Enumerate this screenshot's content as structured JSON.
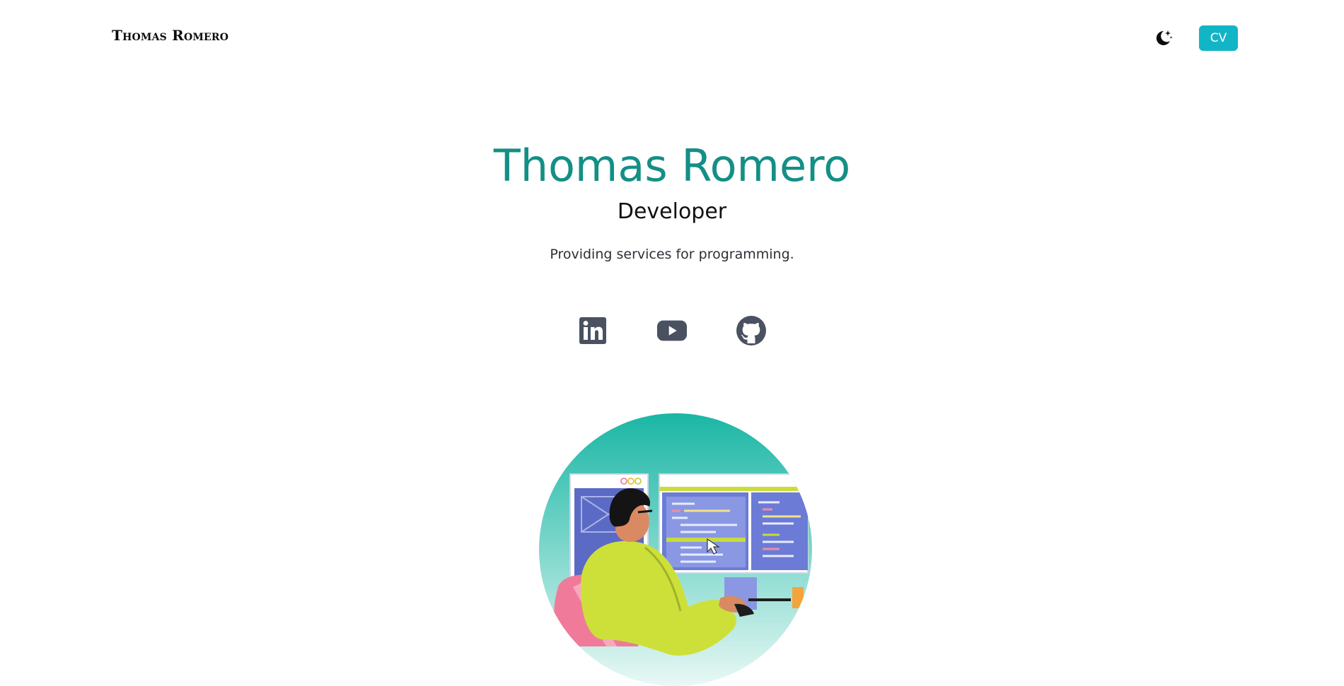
{
  "nav": {
    "brand": "Thomas Romero",
    "theme_toggle_icon": "moon-stars-icon",
    "cv_label": "CV"
  },
  "hero": {
    "name": "Thomas Romero",
    "role": "Developer",
    "tagline": "Providing services for programming."
  },
  "socials": [
    {
      "name": "LinkedIn",
      "icon": "linkedin-icon"
    },
    {
      "name": "YouTube",
      "icon": "youtube-icon"
    },
    {
      "name": "GitHub",
      "icon": "github-icon"
    }
  ],
  "illustration": {
    "description_icon": "developer-at-computer-illustration"
  },
  "colors": {
    "accent": "#138f86",
    "button": "#12b5c6",
    "icon": "#4a5160",
    "text": "#111111"
  }
}
